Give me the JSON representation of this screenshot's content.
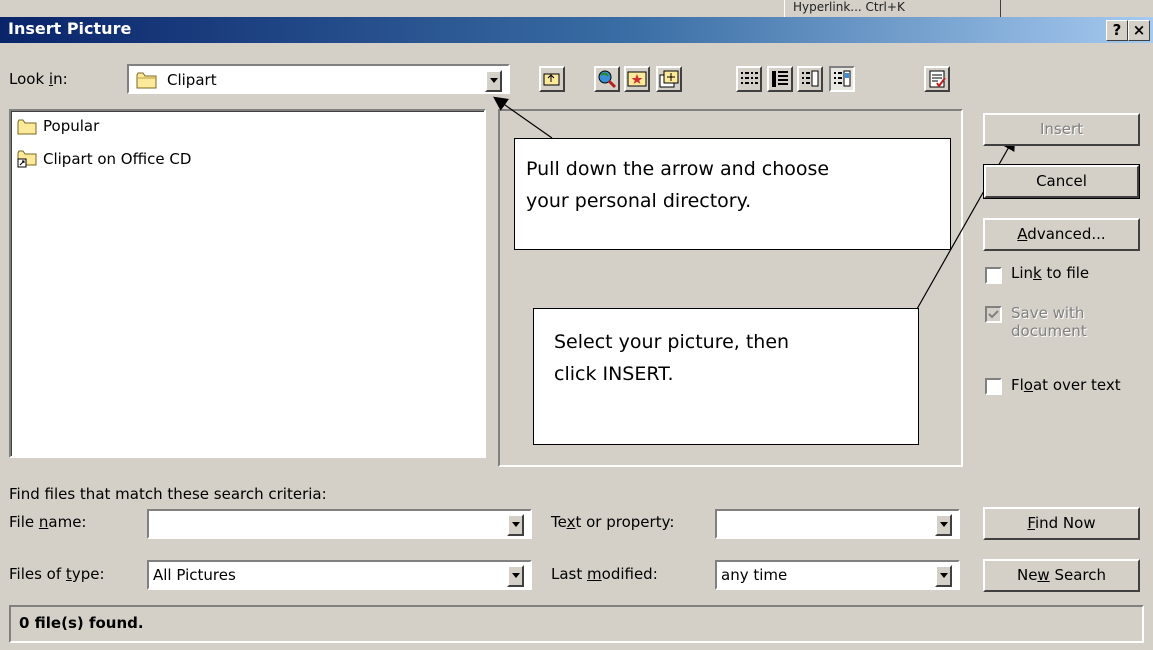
{
  "window": {
    "title": "Insert Picture",
    "help_label": "?",
    "close_label": "×",
    "behind_app_text": "Hyperlink...  Ctrl+K"
  },
  "look_in": {
    "label_pre": "Look ",
    "label_key": "i",
    "label_post": "n:",
    "value": "Clipart"
  },
  "toolbar": {
    "buttons": [
      "up-one-level",
      "search-web",
      "favorites",
      "add-to-favorites",
      "list-view",
      "details-view",
      "properties-view",
      "preview-view",
      "commands-and-settings"
    ]
  },
  "file_list": [
    {
      "label": "Popular",
      "icon": "folder-icon"
    },
    {
      "label": "Clipart on Office CD",
      "icon": "folder-shortcut-icon"
    }
  ],
  "actions": {
    "insert": "Insert",
    "cancel": "Cancel",
    "advanced_key": "A",
    "advanced_rest": "dvanced...",
    "link_pre": "Lin",
    "link_key": "k",
    "link_post": " to file",
    "save_with_line1": "Save with",
    "save_with_line2": "document",
    "float_pre": "Fl",
    "float_key": "o",
    "float_post": "at over text",
    "link_checked": false,
    "save_checked": true,
    "float_checked": false
  },
  "annotations": {
    "callout1_line1": "Pull down the arrow and choose",
    "callout1_line2": "your personal directory.",
    "callout2_line1": "Select your picture, then",
    "callout2_line2": "click INSERT."
  },
  "search": {
    "criteria_label": "Find files that match these search criteria:",
    "file_name_pre": "File ",
    "file_name_key": "n",
    "file_name_post": "ame:",
    "file_name_value": "",
    "files_type_pre": "Files of ",
    "files_type_key": "t",
    "files_type_post": "ype:",
    "files_type_value": "All Pictures",
    "text_prop_pre": "Te",
    "text_prop_key": "x",
    "text_prop_post": "t or property:",
    "text_prop_value": "",
    "last_mod_pre": "Last ",
    "last_mod_key": "m",
    "last_mod_post": "odified:",
    "last_mod_value": "any time",
    "find_now_key": "F",
    "find_now_rest": "ind Now",
    "new_search_pre": "Ne",
    "new_search_key": "w",
    "new_search_post": " Search"
  },
  "status": {
    "text": "0 file(s) found."
  }
}
